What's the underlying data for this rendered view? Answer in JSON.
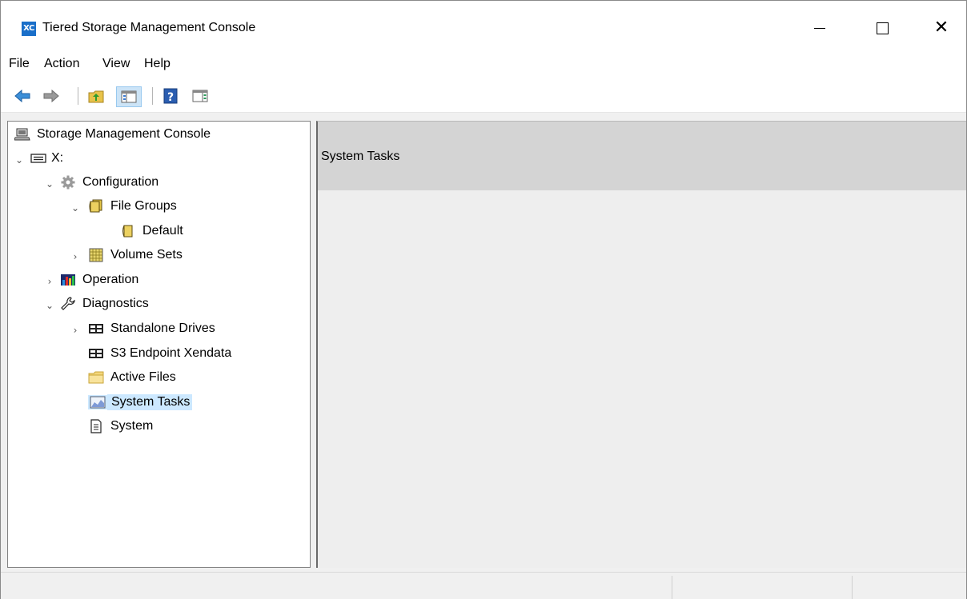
{
  "window": {
    "app_icon_text": "XC",
    "title": "Tiered Storage Management Console",
    "close_glyph": "✕"
  },
  "menu": {
    "items": [
      "File",
      "Action",
      "View",
      "Help"
    ]
  },
  "toolbar": {
    "buttons": [
      {
        "icon": "back-arrow-icon"
      },
      {
        "icon": "forward-arrow-icon"
      },
      {
        "icon": "up-folder-icon"
      },
      {
        "icon": "show-hide-tree-icon"
      },
      {
        "icon": "help-icon"
      },
      {
        "icon": "show-hide-action-pane-icon"
      }
    ]
  },
  "tree": {
    "root": "Storage Management Console",
    "drive": "X:",
    "configuration": "Configuration",
    "file_groups": "File Groups",
    "default": "Default",
    "volume_sets": "Volume Sets",
    "operation": "Operation",
    "diagnostics": "Diagnostics",
    "standalone_drives": "Standalone Drives",
    "s3_endpoint": "S3 Endpoint Xendata",
    "active_files": "Active Files",
    "system_tasks": "System Tasks",
    "system": "System",
    "selected": "System Tasks"
  },
  "result": {
    "title": "System Tasks"
  },
  "colors": {
    "selection": "#cce8ff",
    "header_band": "#d4d4d4",
    "app_icon": "#1a6fc9"
  }
}
